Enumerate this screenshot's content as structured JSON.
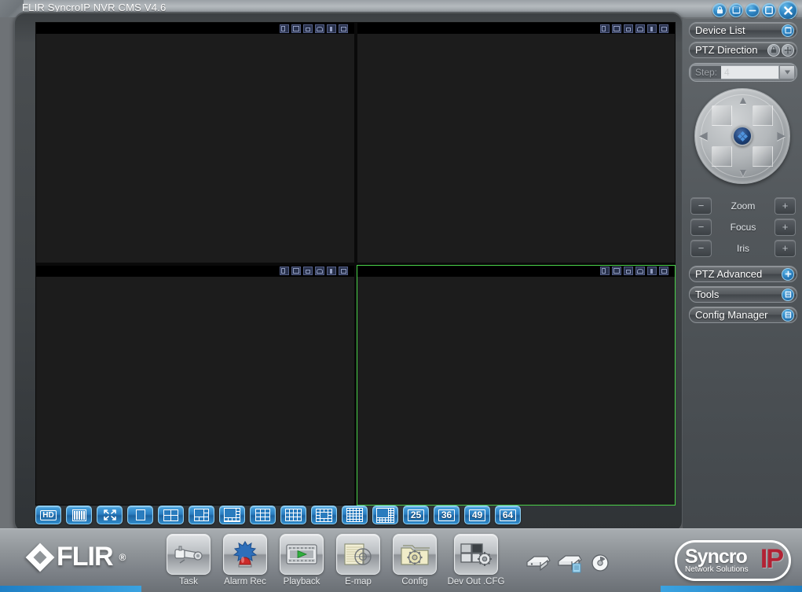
{
  "window": {
    "title": "FLIR SyncroIP NVR CMS  V4.6",
    "controls": [
      {
        "name": "lock-button",
        "glyph": "A"
      },
      {
        "name": "screen-button",
        "glyph": "▣"
      },
      {
        "name": "minimize-button",
        "glyph": "—"
      },
      {
        "name": "maximize-button",
        "glyph": "□"
      },
      {
        "name": "close-button",
        "glyph": "✕"
      }
    ]
  },
  "video": {
    "panel_toolbar_icons": [
      "snapshot-icon",
      "record-icon",
      "instant-playback-icon",
      "ptz-icon",
      "audio-icon",
      "close-panel-icon"
    ],
    "panels": [
      {
        "id": "panel-1",
        "selected": false,
        "stream": ""
      },
      {
        "id": "panel-2",
        "selected": false,
        "stream": ""
      },
      {
        "id": "panel-3",
        "selected": false,
        "stream": ""
      },
      {
        "id": "panel-4",
        "selected": true,
        "stream": ""
      }
    ],
    "selection_color": "#49d149"
  },
  "layout_toolbar": {
    "buttons": [
      {
        "name": "hd-button",
        "label": "HD",
        "kind": "text"
      },
      {
        "name": "bars-button",
        "label": "",
        "kind": "bars"
      },
      {
        "name": "fullscreen-button",
        "label": "",
        "kind": "expand"
      },
      {
        "name": "layout-1-button",
        "label": "1",
        "kind": "grid",
        "cols": 1,
        "rows": 1
      },
      {
        "name": "layout-4-button",
        "label": "4",
        "kind": "grid",
        "cols": 2,
        "rows": 2
      },
      {
        "name": "layout-6-button",
        "label": "6",
        "kind": "grid",
        "cols": 3,
        "rows": 3
      },
      {
        "name": "layout-8-button",
        "label": "8",
        "kind": "grid",
        "cols": 4,
        "rows": 3
      },
      {
        "name": "layout-9-button",
        "label": "9",
        "kind": "grid",
        "cols": 4,
        "rows": 4
      },
      {
        "name": "layout-12-button",
        "label": "12",
        "kind": "grid",
        "cols": 3,
        "rows": 3
      },
      {
        "name": "layout-13-button",
        "label": "13",
        "kind": "grid",
        "cols": 4,
        "rows": 4
      },
      {
        "name": "layout-16-button",
        "label": "16",
        "kind": "grid",
        "cols": 5,
        "rows": 5
      },
      {
        "name": "layout-20-button",
        "label": "20",
        "kind": "grid",
        "cols": 6,
        "rows": 6
      },
      {
        "name": "layout-25-button",
        "label": "25",
        "kind": "num"
      },
      {
        "name": "layout-36-button",
        "label": "36",
        "kind": "num"
      },
      {
        "name": "layout-49-button",
        "label": "49",
        "kind": "num"
      },
      {
        "name": "layout-64-button",
        "label": "64",
        "kind": "num"
      }
    ],
    "numeric_labels": {
      "b25": "25",
      "b36": "36",
      "b49": "49",
      "b64": "64"
    }
  },
  "sidebar": {
    "device_list": {
      "label": "Device List",
      "icon": "window-icon"
    },
    "ptz_direction": {
      "label": "PTZ Direction",
      "icon_lock": "lock-icon",
      "icon_move": "move-icon"
    },
    "step": {
      "label": "Step:",
      "value": "4",
      "placeholder": "4"
    },
    "ptz_pad": {
      "name": "ptz-joystick",
      "center": "ptz-center-button",
      "arrows": {
        "north": "▲",
        "south": "▼",
        "west": "◀",
        "east": "▶"
      }
    },
    "ptz_controls": [
      {
        "name": "zoom",
        "label": "Zoom",
        "minus": "−",
        "plus": "+"
      },
      {
        "name": "focus",
        "label": "Focus",
        "minus": "−",
        "plus": "+"
      },
      {
        "name": "iris",
        "label": "Iris",
        "minus": "−",
        "plus": "+"
      }
    ],
    "ptz_advanced": {
      "label": "PTZ Advanced",
      "icon": "plus-icon"
    },
    "tools": {
      "label": "Tools",
      "icon": "list-icon"
    },
    "config_manager": {
      "label": "Config Manager",
      "icon": "list-icon"
    }
  },
  "taskbar": {
    "brand": "FLIR",
    "brand_mark": "®",
    "buttons": [
      {
        "name": "task-button",
        "label": "Task",
        "icon": "camera-icon"
      },
      {
        "name": "alarm-button",
        "label": "Alarm Rec",
        "icon": "alarm-light-icon"
      },
      {
        "name": "playback-button",
        "label": "Playback",
        "icon": "film-play-icon"
      },
      {
        "name": "emap-button",
        "label": "E-map",
        "icon": "map-icon"
      },
      {
        "name": "config-button",
        "label": "Config",
        "icon": "gear-folder-icon"
      },
      {
        "name": "devout-button",
        "label": "Dev Out .CFG",
        "icon": "grid-gear-icon"
      }
    ],
    "status_icons": [
      "disk-icon",
      "disk-record-icon",
      "cd-icon"
    ],
    "syncro_logo": {
      "line1": "Syncro",
      "line2": "Network Solutions",
      "mark": "IP"
    }
  },
  "colors": {
    "accent_blue": "#2f86c4",
    "panel_bg": "#1c1c1c",
    "selection_green": "#49d149",
    "syncro_red": "#b22234"
  }
}
